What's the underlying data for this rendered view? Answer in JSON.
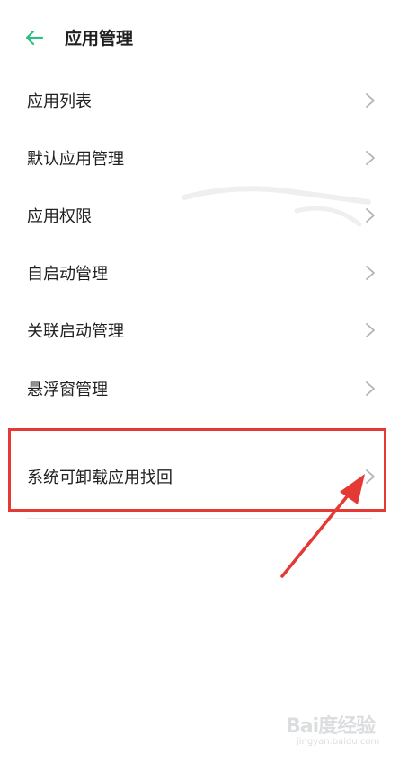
{
  "header": {
    "title": "应用管理",
    "back_icon": "arrow-left-icon",
    "accent_color": "#2ebd85"
  },
  "menu": {
    "items": [
      {
        "label": "应用列表"
      },
      {
        "label": "默认应用管理"
      },
      {
        "label": "应用权限"
      },
      {
        "label": "自启动管理"
      },
      {
        "label": "关联启动管理"
      },
      {
        "label": "悬浮窗管理"
      },
      {
        "label": "系统可卸载应用找回"
      }
    ],
    "chevron_icon": "chevron-right-icon"
  },
  "annotation": {
    "highlight_color": "#e53935"
  },
  "watermark": {
    "logo_text": "Bai度经验",
    "sub_text": "jingyan.baidu.com"
  }
}
